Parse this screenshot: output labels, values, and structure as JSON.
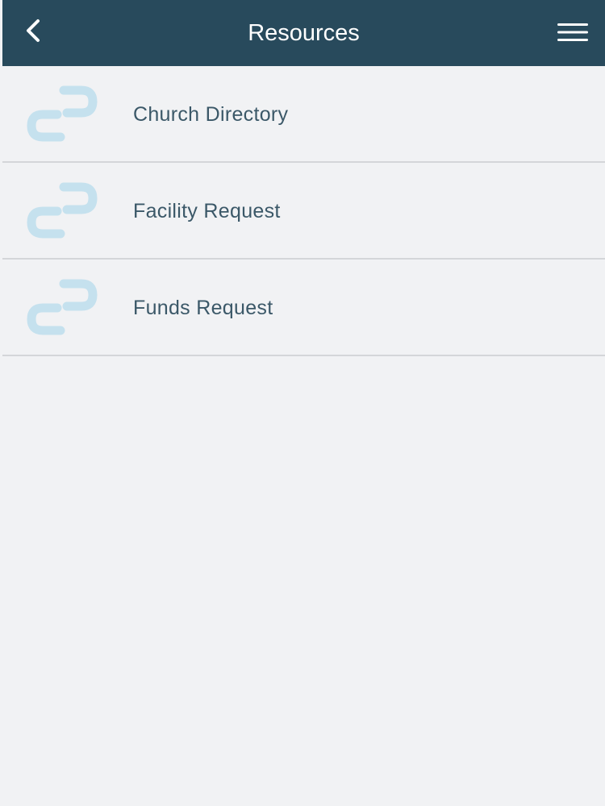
{
  "header": {
    "title": "Resources",
    "back_icon": "chevron-left-icon",
    "menu_icon": "hamburger-menu-icon",
    "background_color": "#284a5c"
  },
  "resources": {
    "items": [
      {
        "label": "Church Directory",
        "icon": "link-icon"
      },
      {
        "label": "Facility Request",
        "icon": "link-icon"
      },
      {
        "label": "Funds Request",
        "icon": "link-icon"
      }
    ],
    "icon_color": "#c5e1ee"
  }
}
